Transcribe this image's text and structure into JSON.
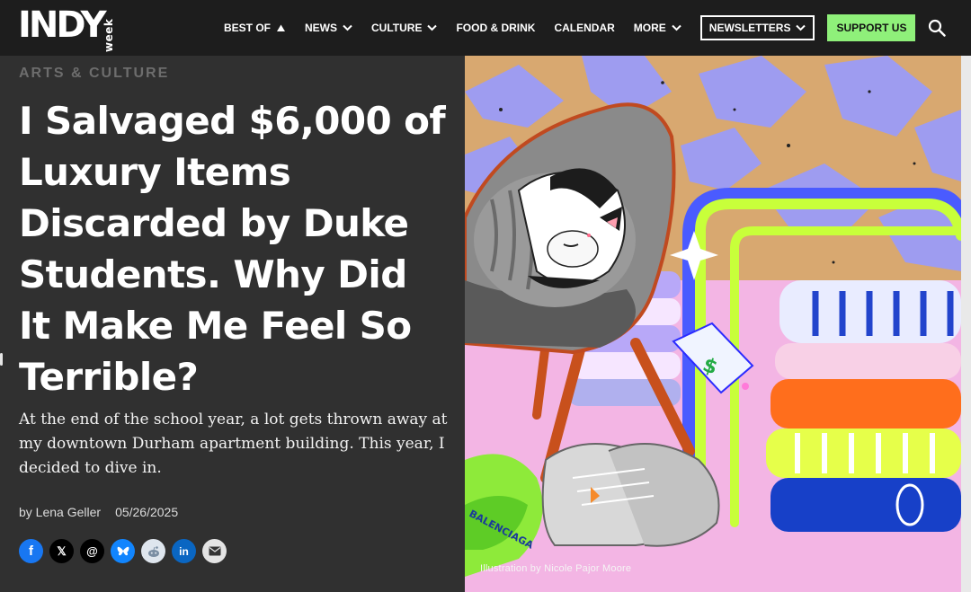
{
  "nav": {
    "logo_main": "INDY",
    "logo_sub": "week",
    "items": [
      {
        "label": "BEST OF",
        "indicator": "triangle-up-icon"
      },
      {
        "label": "NEWS",
        "indicator": "chevron-down-icon"
      },
      {
        "label": "CULTURE",
        "indicator": "chevron-down-icon"
      },
      {
        "label": "FOOD & DRINK",
        "indicator": ""
      },
      {
        "label": "CALENDAR",
        "indicator": ""
      },
      {
        "label": "MORE",
        "indicator": "chevron-down-icon"
      }
    ],
    "newsletters_label": "NEWSLETTERS",
    "support_label": "SUPPORT US",
    "search_icon": "search-icon"
  },
  "article": {
    "category": "ARTS & CULTURE",
    "headline": "I Salvaged $6,000 of Luxury Items Discarded by Duke Students. Why Did It Make Me Feel So Terrible?",
    "dek": "At the end of the school year, a lot gets thrown away at my downtown Durham apartment building. This year, I decided to dive in.",
    "author": "by Lena Geller",
    "date": "05/26/2025",
    "image_credit": "Illustration by Nicole Pajor Moore",
    "illustration_text": "BALENCIAGA"
  },
  "share": [
    {
      "name": "facebook",
      "glyph": "f",
      "bg": "#1877f2",
      "fg": "#ffffff"
    },
    {
      "name": "x",
      "glyph": "𝕏",
      "bg": "#000000",
      "fg": "#ffffff"
    },
    {
      "name": "threads",
      "glyph": "@",
      "bg": "#000000",
      "fg": "#ffffff"
    },
    {
      "name": "bluesky",
      "glyph": "🦋",
      "bg": "#1185fe",
      "fg": "#ffffff"
    },
    {
      "name": "reddit",
      "glyph": "◉",
      "bg": "#dfe6ee",
      "fg": "#5a6b7d"
    },
    {
      "name": "linkedin",
      "glyph": "in",
      "bg": "#0a66c2",
      "fg": "#ffffff"
    },
    {
      "name": "email",
      "glyph": "✉",
      "bg": "#e4e4e4",
      "fg": "#333333"
    }
  ],
  "colors": {
    "nav_bg": "#1d1d1d",
    "page_bg": "#303030",
    "support_bg": "#8ff07a",
    "category": "#6d6d6d"
  }
}
